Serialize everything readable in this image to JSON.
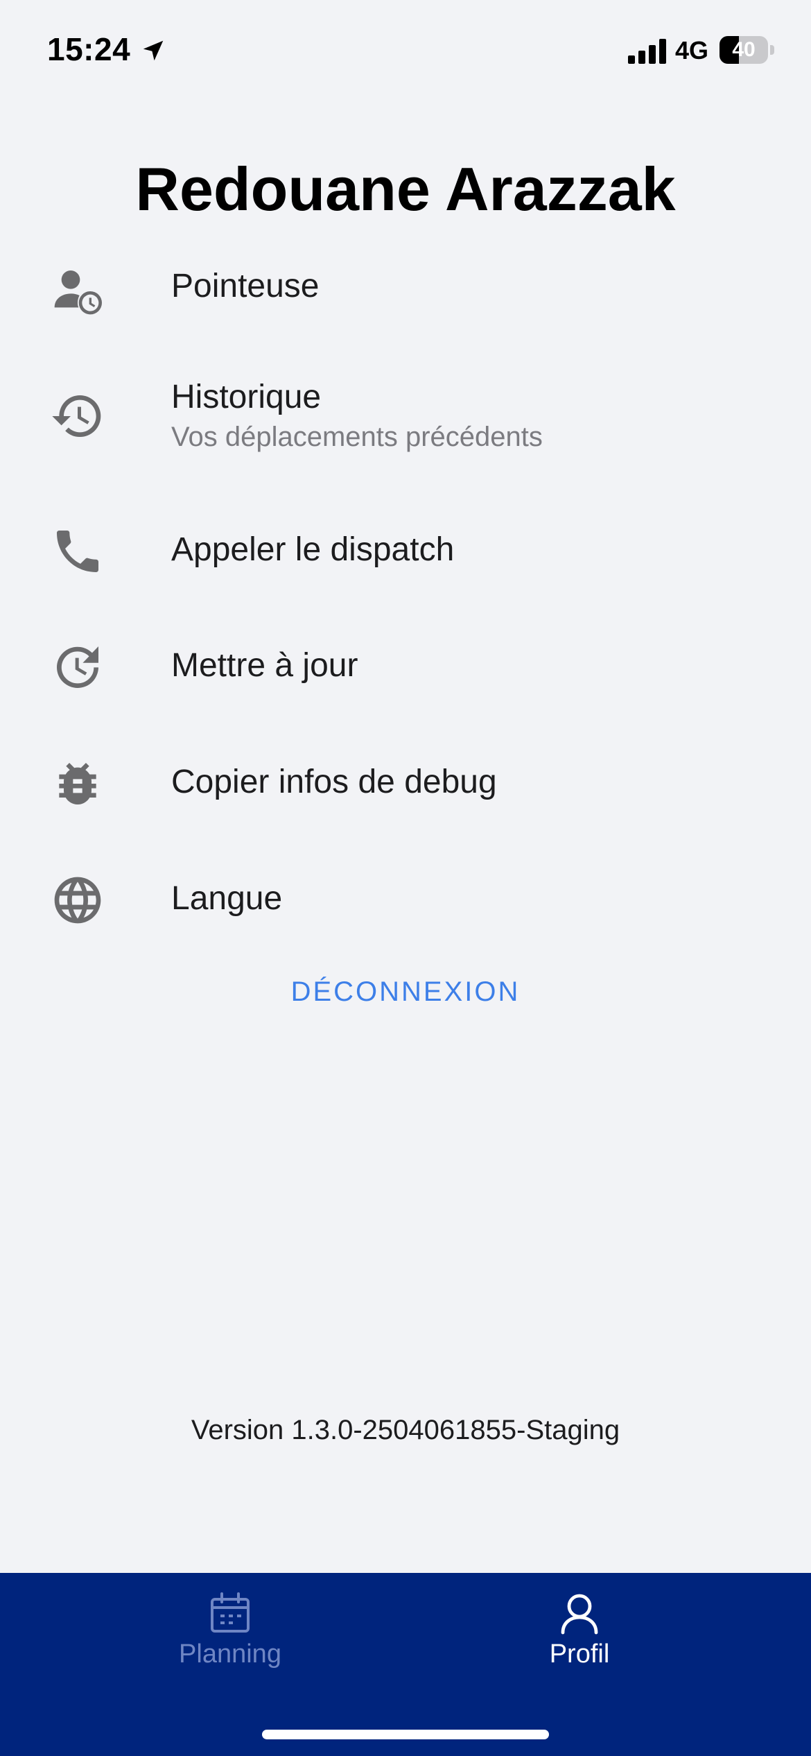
{
  "status_bar": {
    "time": "15:24",
    "network": "4G",
    "battery_level": "40",
    "battery_fraction": 0.4
  },
  "profile": {
    "name": "Redouane Arazzak"
  },
  "menu": {
    "items": [
      {
        "icon": "person-clock-icon",
        "label": "Pointeuse",
        "sublabel": ""
      },
      {
        "icon": "history-icon",
        "label": "Historique",
        "sublabel": "Vos déplacements précédents"
      },
      {
        "icon": "phone-icon",
        "label": "Appeler le dispatch",
        "sublabel": ""
      },
      {
        "icon": "update-icon",
        "label": "Mettre à jour",
        "sublabel": ""
      },
      {
        "icon": "bug-icon",
        "label": "Copier infos de debug",
        "sublabel": ""
      },
      {
        "icon": "globe-icon",
        "label": "Langue",
        "sublabel": ""
      }
    ]
  },
  "logout_label": "DÉCONNEXION",
  "version": "Version 1.3.0-2504061855-Staging",
  "tab_bar": {
    "tabs": [
      {
        "icon": "calendar-icon",
        "label": "Planning",
        "active": false
      },
      {
        "icon": "person-icon",
        "label": "Profil",
        "active": true
      }
    ]
  },
  "colors": {
    "background": "#f2f3f6",
    "tab_bar": "#00247d",
    "accent": "#3d7fe8",
    "icon_gray": "#6b6b6d",
    "inactive_tab": "#6f86c4"
  }
}
